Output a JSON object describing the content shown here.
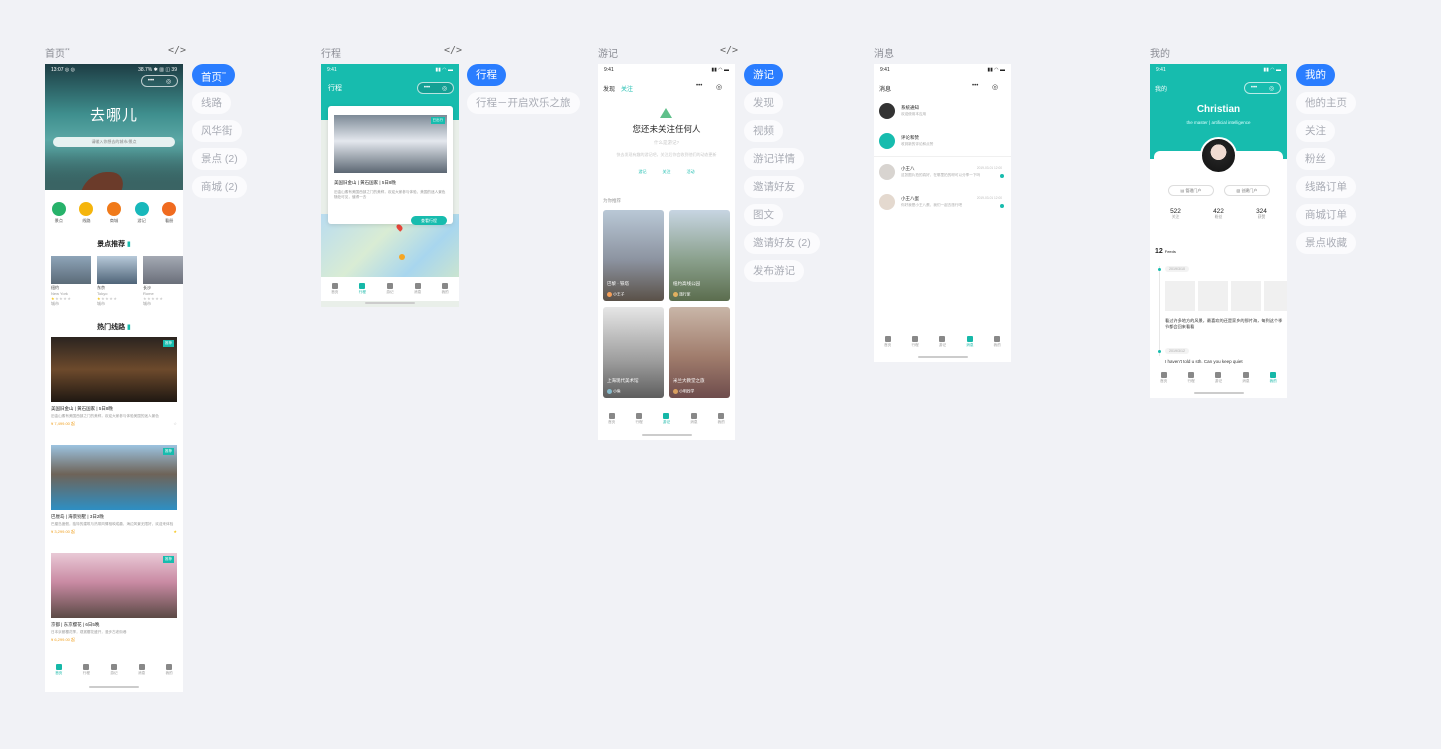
{
  "pages": {
    "home": {
      "title": "首页",
      "sup": "**",
      "code": "</>"
    },
    "trip": {
      "title": "行程",
      "code": "</>"
    },
    "notes": {
      "title": "游记",
      "code": "</>"
    },
    "msg": {
      "title": "消息"
    },
    "me": {
      "title": "我的"
    }
  },
  "home": {
    "status_left": "13:07 ◎ ◎",
    "status_right": "38.7% ✱ ▥ ◫ 39",
    "hero_title": "去哪儿",
    "search_placeholder": "请输入你想去的城市/景点",
    "categories": [
      "景点",
      "线路",
      "商城",
      "游记",
      "看册"
    ],
    "spots_heading": "景点推荐",
    "spots": [
      {
        "name": "纽约",
        "sub": "New York",
        "tag": "城市"
      },
      {
        "name": "东京",
        "sub": "Tokyo",
        "tag": "城市"
      },
      {
        "name": "长沙",
        "sub": "Rome",
        "tag": "城市"
      }
    ],
    "routes_heading": "热门线路",
    "routes": [
      {
        "badge": "推荐",
        "title": "美国旧金山 | 黄石国家 | 5日8晚",
        "desc": "旧金山素有美国西部之门的美称，欢迎大家参与体验美国的迷人景色",
        "price": "¥ 7,499.00 起"
      },
      {
        "badge": "推荐",
        "title": "巴厘岛 | 海景别墅 | 3日2晚",
        "desc": "巴厘岛度假，独特的建筑与热带风情相映成趣，海边风景无限好，欢迎来体验",
        "price": "¥ 3,299.00 起"
      },
      {
        "badge": "推荐",
        "title": "京都 | 东京樱花 | 6日5晚",
        "desc": "日本京都樱花季，观赏樱花盛开，漫步古老街巷",
        "price": "¥ 6,299.00 起"
      }
    ],
    "nav": [
      "首页",
      "行程",
      "游记",
      "消息",
      "我的"
    ]
  },
  "trip": {
    "status_left": "9:41",
    "header": "行程",
    "card_badge": "已出行",
    "card_title": "美国旧金山 | 黄石国家 | 5日8晚",
    "card_desc": "旧金山素有美国西部之门的美称，欢迎大家参与体验，美国的迷人景色随处可见，值得一去",
    "card_btn": "查看行程",
    "nav": [
      "首页",
      "行程",
      "游记",
      "消息",
      "我的"
    ]
  },
  "notes": {
    "status_left": "9:41",
    "tab_a": "发现",
    "tab_b": "关注",
    "empty_title": "您还未关注任何人",
    "empty_sub": "什么是游记?",
    "empty_desc": "快去发现有趣的游记吧，关注后你会收到他们的动态更新",
    "mini": [
      "游记",
      "关注",
      "活动"
    ],
    "recommend": "为你推荐",
    "cards": [
      {
        "title": "巴黎 · 铁塔",
        "user": "小王子"
      },
      {
        "title": "纽约高线公园",
        "user": "旅行家"
      },
      {
        "title": "上海现代美术馆",
        "user": "小鱼"
      },
      {
        "title": "米兰大教堂之旅",
        "user": "小明同学"
      }
    ],
    "nav": [
      "首页",
      "行程",
      "游记",
      "消息",
      "我的"
    ]
  },
  "msg": {
    "status_left": "9:41",
    "header": "消息",
    "items": [
      {
        "name": "系统通知",
        "text": "欢迎使用本应用",
        "time": ""
      },
      {
        "name": "评论和赞",
        "text": "收到新的评论和点赞",
        "time": ""
      },
      {
        "name": "小王八",
        "text": "这张图片拍的真好，在哪里拍的呀可以分享一下吗",
        "time": "2019-03-01 12:00"
      },
      {
        "name": "小王八蛋",
        "text": "你好我是小王八蛋，我们一起去旅行吧",
        "time": "2019-03-01 12:00"
      }
    ],
    "nav": [
      "首页",
      "行程",
      "游记",
      "消息",
      "我的"
    ]
  },
  "me": {
    "status_left": "9:41",
    "header": "我的",
    "name": "Christian",
    "subtitle": "the master | artificial intelligence",
    "btn_a": "管理门户",
    "btn_b": "创建门户",
    "stats": [
      {
        "num": "522",
        "label": "关注"
      },
      {
        "num": "422",
        "label": "粉丝"
      },
      {
        "num": "324",
        "label": "获赞"
      }
    ],
    "feed_count": "12",
    "feed_label": "Feeds",
    "feed_date1": "2019/3/10",
    "feed_text": "看过许多地方的风景，最喜欢的还是家乡的那片海，每到这个季节都会回来看看",
    "feed_date2": "2019/3/12",
    "feed_text2": "I haven't told u sth. Can you keep quiet",
    "nav": [
      "首页",
      "行程",
      "游记",
      "消息",
      "我的"
    ]
  },
  "chips": {
    "home": [
      "首页",
      "线路",
      "风华街",
      "景点 (2)",
      "商城 (2)"
    ],
    "trip": [
      "行程",
      "行程－开启欢乐之旅"
    ],
    "notes": [
      "游记",
      "发现",
      "视频",
      "游记详情",
      "邀请好友",
      "图文",
      "邀请好友 (2)",
      "发布游记"
    ],
    "me": [
      "我的",
      "他的主页",
      "关注",
      "粉丝",
      "线路订单",
      "商城订单",
      "景点收藏"
    ]
  },
  "colors": {
    "accent": "#17bcae",
    "chip_active": "#2a7dff",
    "page_bg": "#f1f2f6"
  }
}
